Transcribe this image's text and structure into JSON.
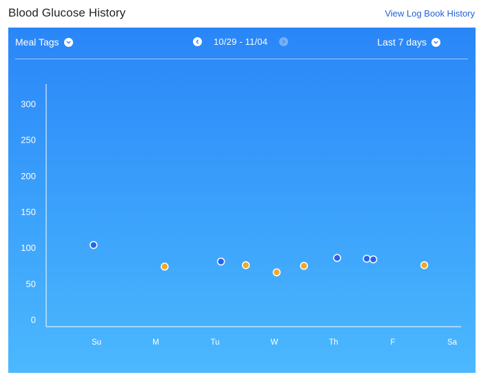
{
  "header": {
    "title": "Blood Glucose History",
    "log_link": "View Log Book History"
  },
  "toolbar": {
    "meal_tags_label": "Meal Tags",
    "date_range": "10/29 - 11/04",
    "period_label": "Last 7 days",
    "prev_icon": "chevron-left-icon",
    "next_icon": "chevron-right-icon",
    "next_enabled": false
  },
  "colors": {
    "card_top": "#2a86f8",
    "card_bottom": "#4cb8fe",
    "series_blue": "#2563eb",
    "series_orange": "#f5a623"
  },
  "chart_data": {
    "type": "scatter",
    "y_ticks": [
      "300",
      "250",
      "200",
      "150",
      "100",
      "50",
      "0"
    ],
    "ylim": [
      0,
      300
    ],
    "x_ticks": [
      "Su",
      "M",
      "Tu",
      "W",
      "Th",
      "F",
      "Sa"
    ],
    "xlim": [
      0,
      7
    ],
    "grid": false,
    "points": [
      {
        "x": 0.45,
        "y": 104,
        "color": "blue"
      },
      {
        "x": 1.65,
        "y": 74,
        "color": "orange"
      },
      {
        "x": 2.6,
        "y": 81,
        "color": "blue"
      },
      {
        "x": 3.02,
        "y": 76,
        "color": "orange"
      },
      {
        "x": 3.54,
        "y": 66,
        "color": "orange"
      },
      {
        "x": 4.0,
        "y": 75,
        "color": "orange"
      },
      {
        "x": 4.56,
        "y": 86,
        "color": "blue"
      },
      {
        "x": 5.06,
        "y": 85,
        "color": "blue"
      },
      {
        "x": 5.17,
        "y": 84,
        "color": "blue"
      },
      {
        "x": 6.03,
        "y": 76,
        "color": "orange"
      }
    ]
  }
}
